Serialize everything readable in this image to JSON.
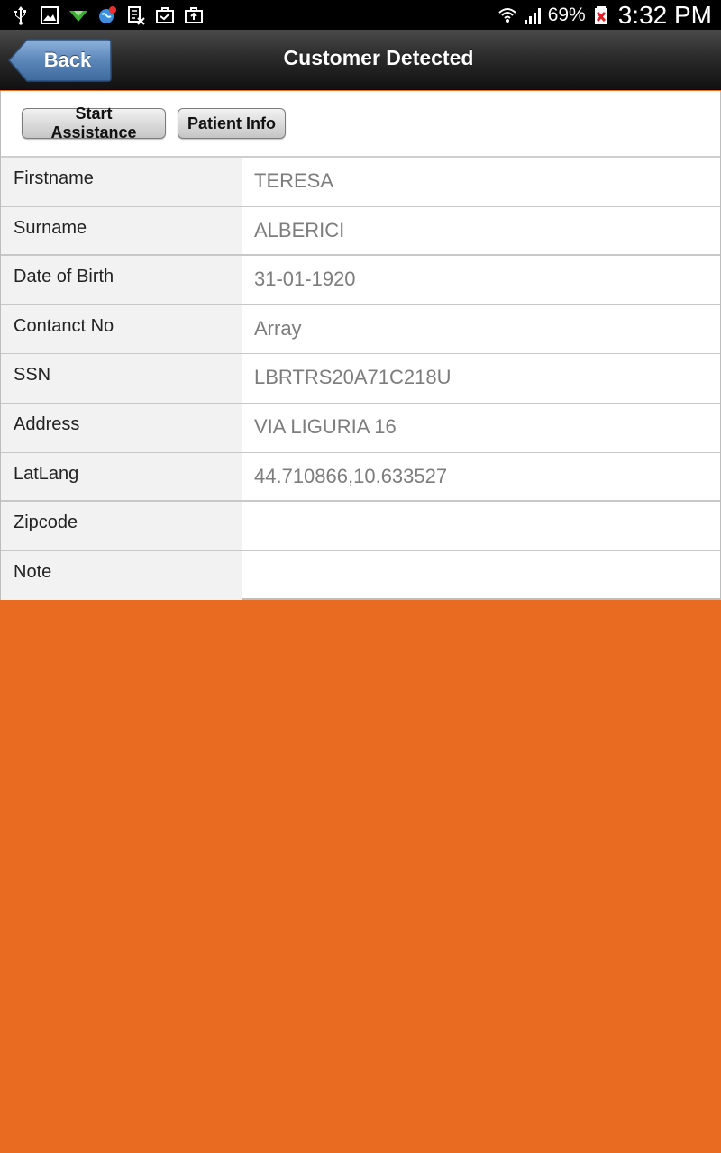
{
  "status_bar": {
    "battery_percent": "69%",
    "time": "3:32 PM",
    "left_icons": [
      "usb-icon",
      "image-icon",
      "download-icon",
      "globe-notification-icon",
      "spreadsheet-icon",
      "briefcase-check-icon",
      "briefcase-upload-icon"
    ],
    "right_icons": [
      "wifi-icon",
      "signal-icon",
      "battery-icon"
    ]
  },
  "nav": {
    "back_label": "Back",
    "title": "Customer Detected"
  },
  "actions": {
    "start_assistance": "Start Assistance",
    "patient_info": "Patient Info"
  },
  "fields": [
    {
      "label": "Firstname",
      "value": "TERESA"
    },
    {
      "label": "Surname",
      "value": "ALBERICI"
    },
    {
      "label": "Date of Birth",
      "value": "31-01-1920"
    },
    {
      "label": "Contanct No",
      "value": "Array"
    },
    {
      "label": "SSN",
      "value": "LBRTRS20A71C218U"
    },
    {
      "label": "Address",
      "value": "VIA LIGURIA 16"
    },
    {
      "label": "LatLang",
      "value": "44.710866,10.633527"
    },
    {
      "label": "Zipcode",
      "value": ""
    },
    {
      "label": "Note",
      "value": ""
    }
  ],
  "colors": {
    "background": "#e96b21",
    "back_button": "#5b86b8",
    "nav_bar": "#2b2b2b"
  }
}
